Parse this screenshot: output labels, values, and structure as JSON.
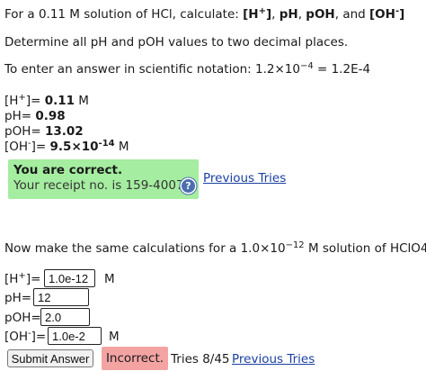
{
  "q1": {
    "pre": "For a 0.11 M solution of HCl, calculate: ",
    "h": "[H",
    "hsup": "+",
    "hclose": "]",
    "sep1": ", ",
    "ph": "pH",
    "sep2": ", ",
    "poh": "pOH",
    "sep3": ", and ",
    "oh": "[OH",
    "ohsup": "-",
    "ohclose": "]"
  },
  "instructions": "Determine all pH and pOH values to two decimal places.",
  "sci": {
    "pre": "To enter an answer in scientific notation: 1.2×10",
    "sup": "−4",
    "post": " = 1.2E-4"
  },
  "answers": {
    "h": {
      "label": "[H",
      "sup": "+",
      "close": "]= ",
      "value": "0.11",
      "unit": " M"
    },
    "ph": {
      "label": "pH= ",
      "value": "0.98"
    },
    "poh": {
      "label": "pOH= ",
      "value": "13.02"
    },
    "oh": {
      "label": "[OH",
      "sup": "-",
      "close": "]= ",
      "value": "9.5×10",
      "valuesup": "-14",
      "unit": " M"
    }
  },
  "correct": {
    "title": "You are correct.",
    "receipt": "Your receipt no. is 159-4007"
  },
  "previous_tries": "Previous Tries",
  "q2": {
    "pre": "Now make the same calculations for a 1.0×10",
    "sup": "−12",
    "post": " M solution of HClO4."
  },
  "form": {
    "h": {
      "label": "[H",
      "sup": "+",
      "close": "]=",
      "value": "1.0e-12",
      "unit": "M"
    },
    "ph": {
      "label": "pH=",
      "value": "12"
    },
    "poh": {
      "label": "pOH=",
      "value": "2.0"
    },
    "oh": {
      "label": "[OH",
      "sup": "-",
      "close": "]=",
      "value": "1.0e-2",
      "unit": "M"
    }
  },
  "submit_label": "Submit Answer",
  "incorrect_label": "Incorrect.",
  "tries": "Tries 8/45",
  "icons": {
    "help": "help-question-icon"
  }
}
